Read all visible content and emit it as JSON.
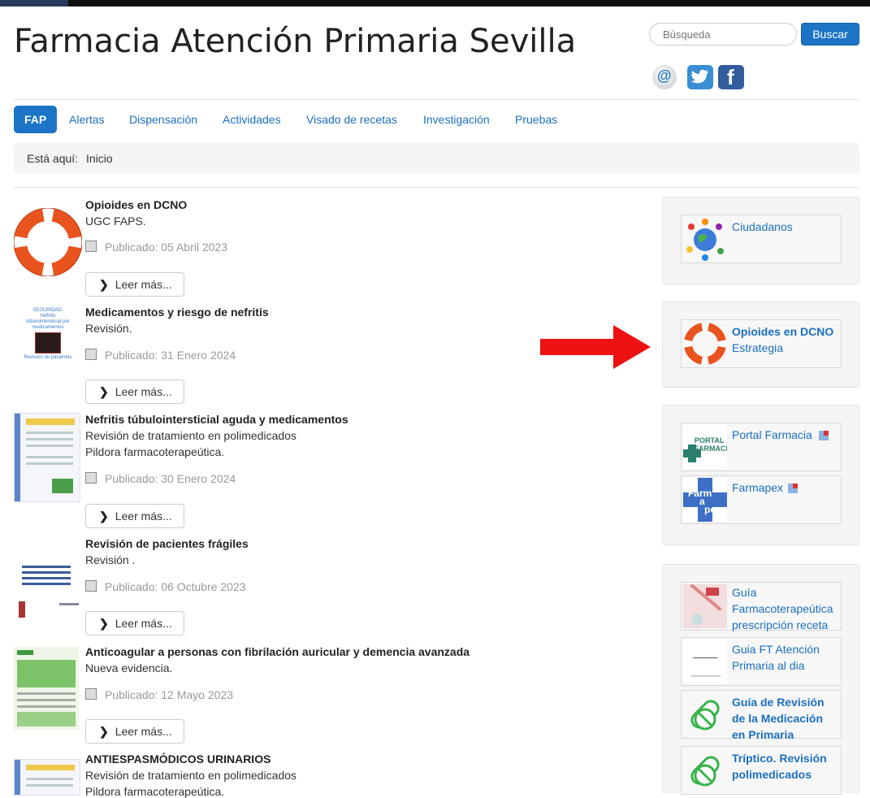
{
  "site": {
    "title": "Farmacia Atención Primaria Sevilla"
  },
  "search": {
    "placeholder": "Búsqueda",
    "button_label": "Buscar"
  },
  "social": [
    "email-icon",
    "twitter-icon",
    "facebook-icon"
  ],
  "nav": {
    "items": [
      "FAP",
      "Alertas",
      "Dispensación",
      "Actividades",
      "Visado de recetas",
      "Investigación",
      "Pruebas"
    ],
    "active": "FAP"
  },
  "breadcrumb": {
    "label": "Está aquí:",
    "current": "Inicio"
  },
  "articles": [
    {
      "title": "Opioides en DCNO",
      "lines": [
        "UGC FAPS."
      ],
      "date": "Publicado: 05 Abril 2023",
      "more": "Leer más..."
    },
    {
      "title": "Medicamentos y riesgo de nefritis",
      "lines": [
        "Revisión."
      ],
      "date": "Publicado: 31 Enero 2024",
      "more": "Leer más...",
      "thumb_text": [
        "SEGURIDAD:",
        "Nefritis",
        "túbulointersticial por",
        "medicamentos",
        "Revisión de pacientes"
      ]
    },
    {
      "title": "Nefritis túbulointersticial aguda y medicamentos",
      "lines": [
        "Revisión de tratamiento en polimedicados",
        "Pildora farmacoterapeútica."
      ],
      "date": "Publicado: 30 Enero 2024",
      "more": "Leer más..."
    },
    {
      "title": "Revisión de pacientes frágiles",
      "lines": [
        "Revisión ."
      ],
      "date": "Publicado: 06 Octubre 2023",
      "more": "Leer más..."
    },
    {
      "title": "Anticoagular a personas con fibrilación auricular y demencia avanzada",
      "lines": [
        "Nueva evidencia."
      ],
      "date": "Publicado: 12 Mayo 2023",
      "more": "Leer más..."
    },
    {
      "title": "ANTIESPASMÓDICOS URINARIOS",
      "lines": [
        "Revisión de tratamiento en polimedicados",
        "Pildora farmacoterapeútica."
      ]
    }
  ],
  "sidebar": {
    "ciudadanos": "Ciudadanos",
    "opioides": {
      "line1": "Opioides en DCNO",
      "line2": "Estrategia"
    },
    "portal": "Portal Farmacia",
    "portal_logo": [
      "PORTAL",
      "FARMACIA"
    ],
    "farmapex": "Farmapex",
    "farmapex_logo": [
      "Farm",
      "a",
      "pex"
    ],
    "guia_ft": [
      "Guía",
      "Farmacoterapeútica",
      "prescripción receta"
    ],
    "guia_ap": [
      "Guia FT Atención",
      "Primaria al dia"
    ],
    "guia_revision": [
      "Guía de Revisión",
      "de la Medicación",
      "en Primaria"
    ],
    "triptico": [
      "Tríptico. Revisión",
      "polimedicados"
    ]
  },
  "colors": {
    "accent": "#1b74c5",
    "link": "#1b6fc0",
    "arrow": "#ee1111",
    "lifebuoy": "#e8531e",
    "green": "#37b34a"
  }
}
